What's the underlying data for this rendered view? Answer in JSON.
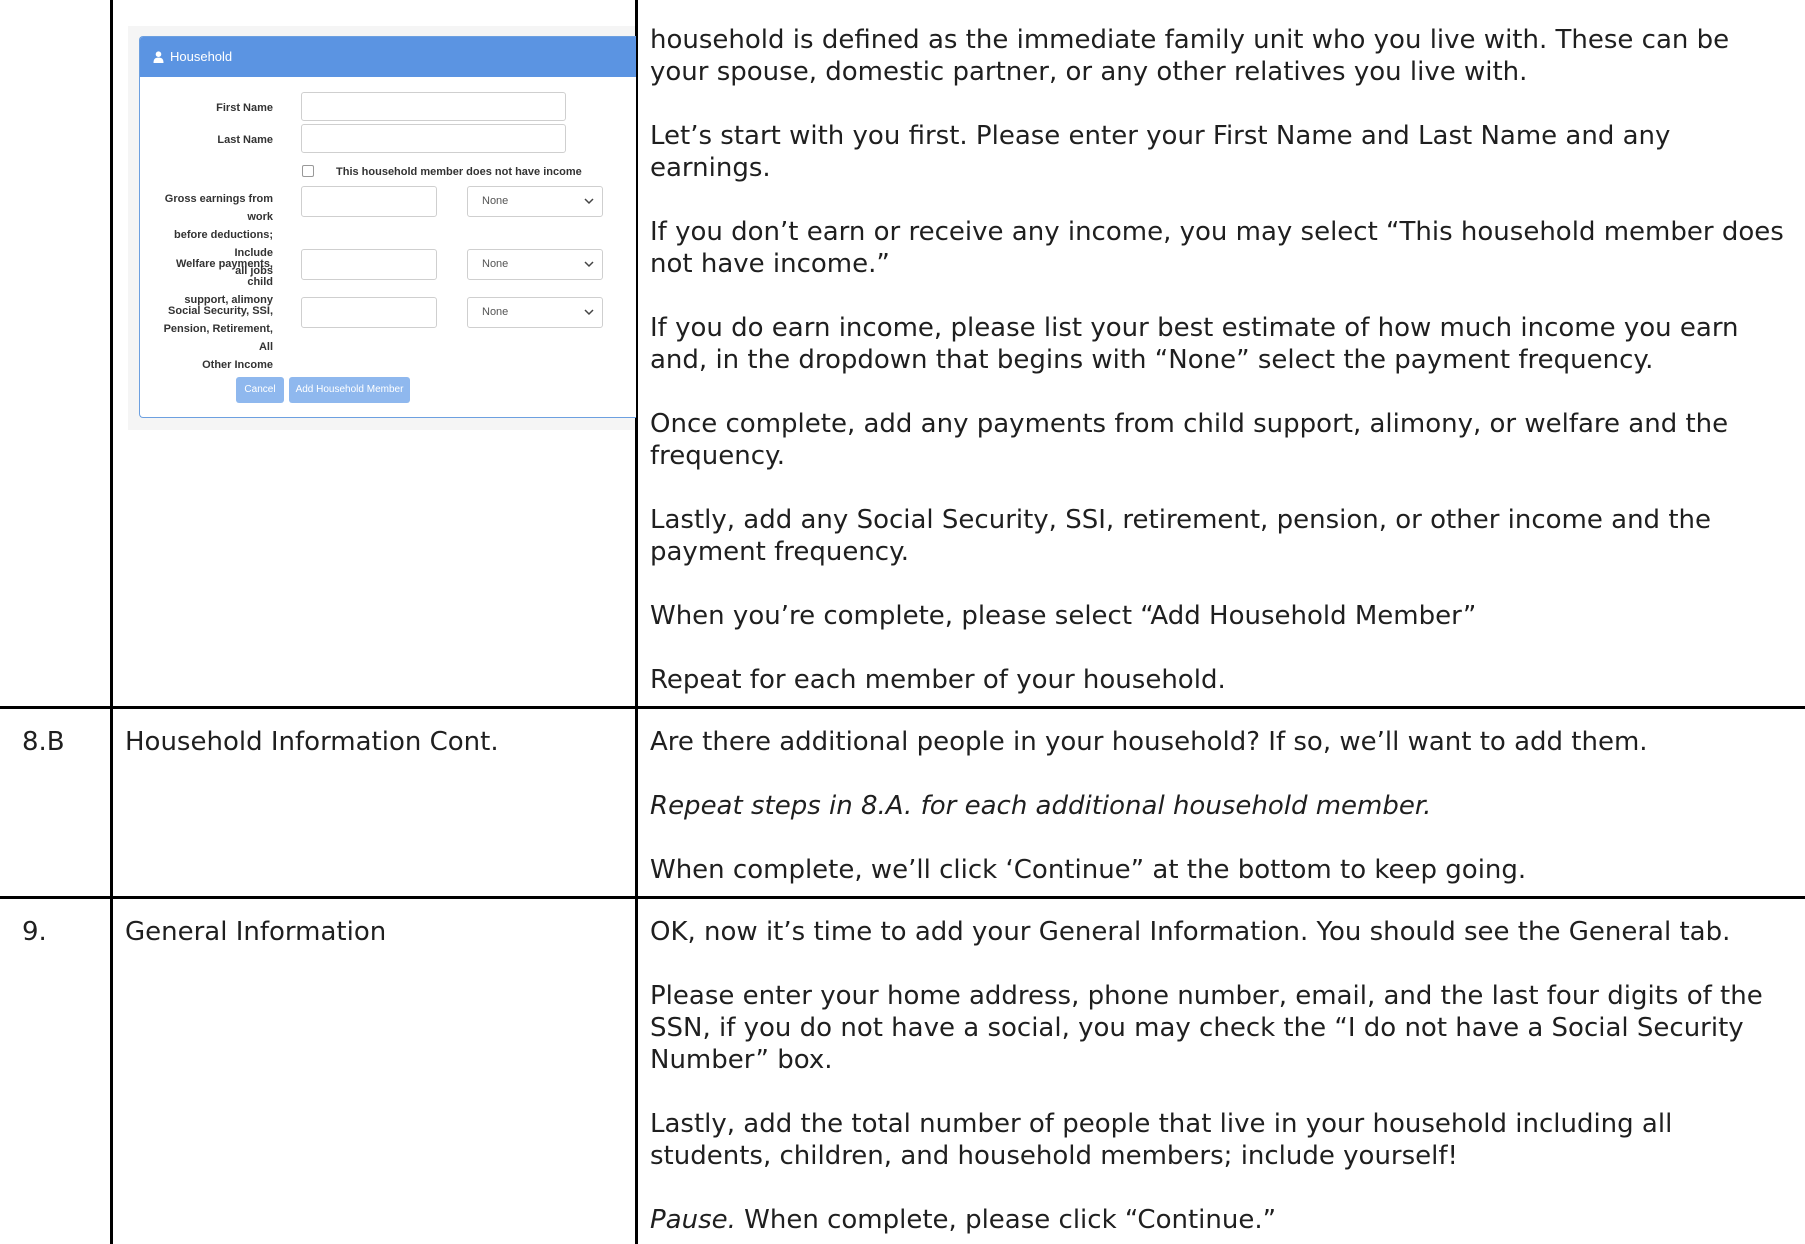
{
  "row_8a": {
    "form": {
      "header_title": "Household",
      "first_name_label": "First Name",
      "last_name_label": "Last Name",
      "no_income_label": "This household member does not have income",
      "gross_earnings_label": [
        "Gross earnings from work",
        "before deductions; Include",
        "all jobs"
      ],
      "welfare_label": [
        "Welfare payments, child",
        "support, alimony"
      ],
      "social_security_label": [
        "Social Security, SSI,",
        "Pension, Retirement, All",
        "Other Income"
      ],
      "frequency_default": "None",
      "cancel_label": "Cancel",
      "add_member_label": "Add Household Member"
    },
    "paragraphs": [
      [
        "household is defined as the immediate family unit who you live with.  These can be",
        "your spouse, domestic partner, or any other relatives you live with."
      ],
      [
        "Let’s start with you first. Please enter your First Name and Last Name and any",
        "earnings."
      ],
      [
        "If you don’t earn or receive any income, you may select “This household member does",
        "not have income.”"
      ],
      [
        "If you do earn income, please list your best estimate of how much income you earn",
        "and, in the dropdown that begins with “None” select the payment frequency."
      ],
      [
        "Once complete, add any payments from child support, alimony, or welfare and the",
        "frequency."
      ],
      [
        "Lastly, add any Social Security, SSI, retirement, pension, or other income and the",
        "payment frequency."
      ],
      [
        "When you’re complete, please select “Add Household Member”"
      ],
      [
        "Repeat for each member of your household."
      ]
    ]
  },
  "row_8b": {
    "step": "8.B",
    "title": "Household Information Cont.",
    "p1": "Are there additional people in your household? If so, we’ll want to add them.",
    "p2_italic": "Repeat steps in 8.A. for each additional household member.",
    "p3": "When complete, we’ll click ‘Continue” at the bottom to keep going."
  },
  "row_9": {
    "step": "9.",
    "title": "General Information",
    "p1": "OK, now it’s time to add your General Information. You should see the General tab.",
    "p2": [
      "Please enter your home address, phone number, email, and the last four digits of the",
      "SSN, if you do not have a social, you may check the “I do not have a Social Security",
      "Number” box."
    ],
    "p3": [
      "Lastly, add the total number of people that live in your household including all",
      "students, children, and household members; include yourself!"
    ],
    "p4_italic": "Pause.",
    "p4_rest": " When complete, please click “Continue.”"
  }
}
